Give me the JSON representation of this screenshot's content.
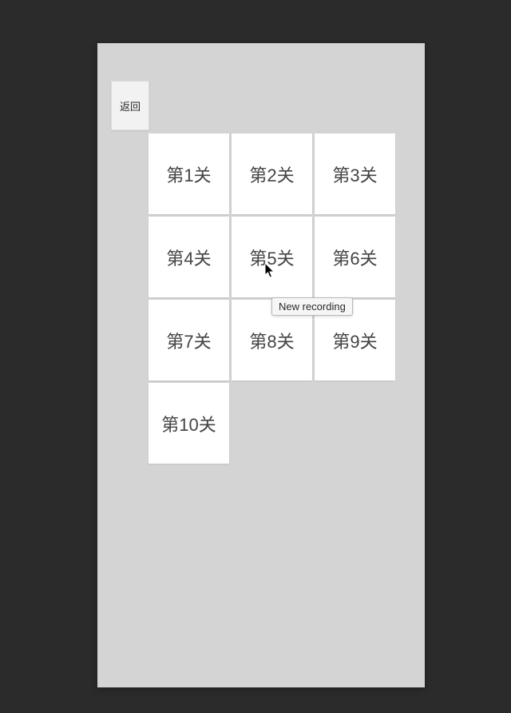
{
  "back_label": "返回",
  "levels": [
    "第1关",
    "第2关",
    "第3关",
    "第4关",
    "第5关",
    "第6关",
    "第7关",
    "第8关",
    "第9关",
    "第10关"
  ],
  "tooltip_text": "New recording"
}
